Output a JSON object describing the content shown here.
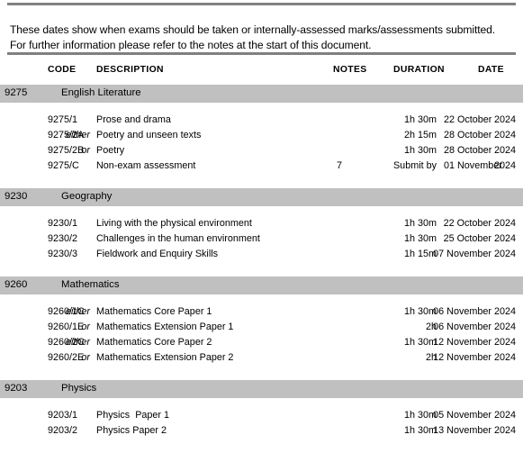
{
  "document": {
    "intro_text": "These dates show when exams should be taken or internally-assessed marks/assessments submitted.  For further information please refer to the notes at the start of this document.",
    "band_color": "#c0c0c0",
    "rule_color": "#808080"
  },
  "column_headers": {
    "code": "CODE",
    "description": "DESCRIPTION",
    "notes": "NOTES",
    "duration": "DURATION",
    "date": "DATE"
  },
  "sections": [
    {
      "code": "9275",
      "title": "English Literature",
      "date_style": "split",
      "rows": [
        {
          "either": "",
          "code": "9275/1",
          "description": "Prose and drama",
          "notes": "",
          "duration": "1h 30m",
          "day": "22",
          "month": "October",
          "year": "2024",
          "full_date": "22 October 2024"
        },
        {
          "either": "either",
          "code": "9275/2A",
          "description": "Poetry and unseen texts",
          "notes": "",
          "duration": "2h 15m",
          "day": "28",
          "month": "October",
          "year": "2024",
          "full_date": "28 October 2024"
        },
        {
          "either": "or",
          "code": "9275/2B",
          "description": "Poetry",
          "notes": "",
          "duration": "1h 30m",
          "day": "28",
          "month": "October",
          "year": "2024",
          "full_date": "28 October 2024"
        },
        {
          "either": "",
          "code": "9275/C",
          "description": "Non-exam assessment",
          "notes": "7",
          "duration": "Submit by",
          "day": "01",
          "month": "November",
          "year": "2024",
          "full_date": "01 November 2024"
        }
      ]
    },
    {
      "code": "9230",
      "title": "Geography",
      "date_style": "full",
      "rows": [
        {
          "either": "",
          "code": "9230/1",
          "description": "Living with the physical environment",
          "notes": "",
          "duration": "1h 30m",
          "day": "22",
          "month": "October",
          "year": "2024",
          "full_date": "22 October 2024"
        },
        {
          "either": "",
          "code": "9230/2",
          "description": "Challenges in the human environment",
          "notes": "",
          "duration": "1h 30m",
          "day": "25",
          "month": "October",
          "year": "2024",
          "full_date": "25 October 2024"
        },
        {
          "either": "",
          "code": "9230/3",
          "description": "Fieldwork and Enquiry Skills",
          "notes": "",
          "duration": "1h 15m",
          "day": "07",
          "month": "November",
          "year": "2024",
          "full_date": "07 November 2024"
        }
      ]
    },
    {
      "code": "9260",
      "title": "Mathematics",
      "date_style": "full",
      "rows": [
        {
          "either": "either",
          "code": "9260/1C",
          "description": "Mathematics Core Paper 1",
          "notes": "",
          "duration": "1h 30m",
          "day": "06",
          "month": "November",
          "year": "2024",
          "full_date": "06 November 2024"
        },
        {
          "either": "or",
          "code": "9260/1E",
          "description": "Mathematics Extension Paper 1",
          "notes": "",
          "duration": "2h",
          "day": "06",
          "month": "November",
          "year": "2024",
          "full_date": "06 November 2024"
        },
        {
          "either": "either",
          "code": "9260/2C",
          "description": "Mathematics Core Paper 2",
          "notes": "",
          "duration": "1h 30m",
          "day": "12",
          "month": "November",
          "year": "2024",
          "full_date": "12 November 2024"
        },
        {
          "either": "or",
          "code": "9260/2E",
          "description": "Mathematics Extension Paper 2",
          "notes": "",
          "duration": "2h",
          "day": "12",
          "month": "November",
          "year": "2024",
          "full_date": "12 November 2024"
        }
      ]
    },
    {
      "code": "9203",
      "title": "Physics",
      "date_style": "full",
      "rows": [
        {
          "either": "",
          "code": "9203/1",
          "description": "Physics  Paper 1",
          "notes": "",
          "duration": "1h 30m",
          "day": "05",
          "month": "November",
          "year": "2024",
          "full_date": "05 November 2024"
        },
        {
          "either": "",
          "code": "9203/2",
          "description": "Physics Paper 2",
          "notes": "",
          "duration": "1h 30m",
          "day": "13",
          "month": "November",
          "year": "2024",
          "full_date": "13 November 2024"
        }
      ]
    }
  ]
}
